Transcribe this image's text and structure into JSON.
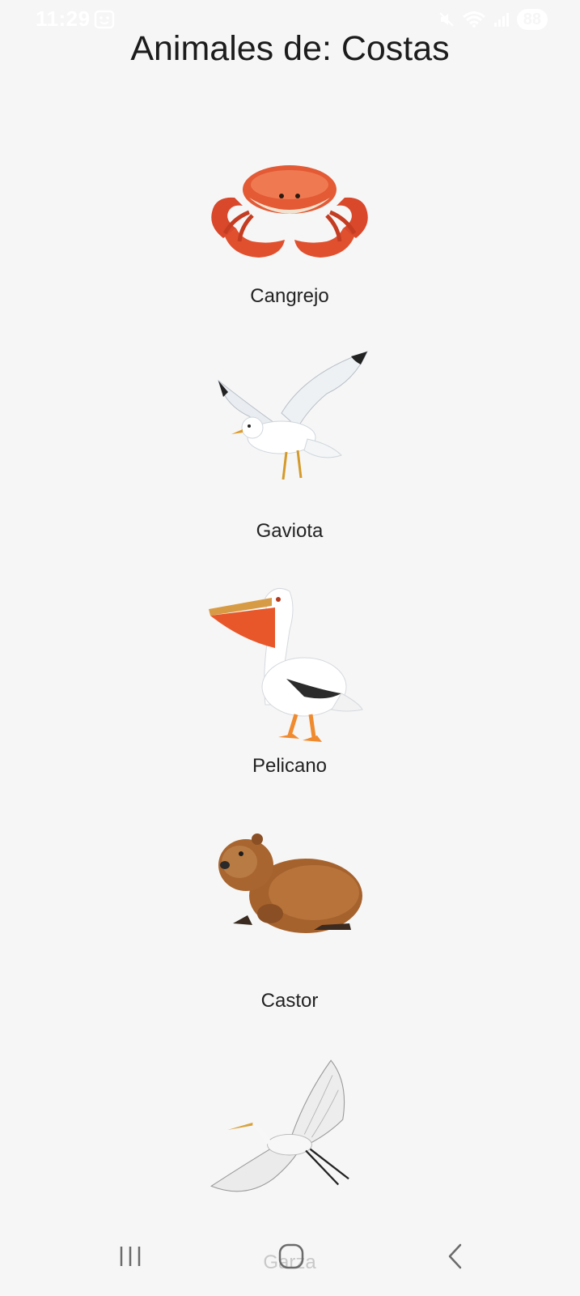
{
  "status_bar": {
    "time": "11:29",
    "battery": "88",
    "icons": [
      "face-scan-icon",
      "mute-icon",
      "wifi-icon",
      "signal-icon",
      "battery-icon"
    ]
  },
  "page": {
    "title": "Animales de: Costas"
  },
  "animals": [
    {
      "name": "Cangrejo",
      "icon": "crab-image"
    },
    {
      "name": "Gaviota",
      "icon": "seagull-image"
    },
    {
      "name": "Pelicano",
      "icon": "pelican-image"
    },
    {
      "name": "Castor",
      "icon": "beaver-image"
    },
    {
      "name": "Garza",
      "icon": "heron-image"
    }
  ],
  "nav_bar": {
    "buttons": [
      "recent-apps-icon",
      "home-icon",
      "back-icon"
    ]
  },
  "colors": {
    "background": "#f6f6f6",
    "text": "#1c1c1c",
    "nav_icon": "#6b6b6b"
  }
}
